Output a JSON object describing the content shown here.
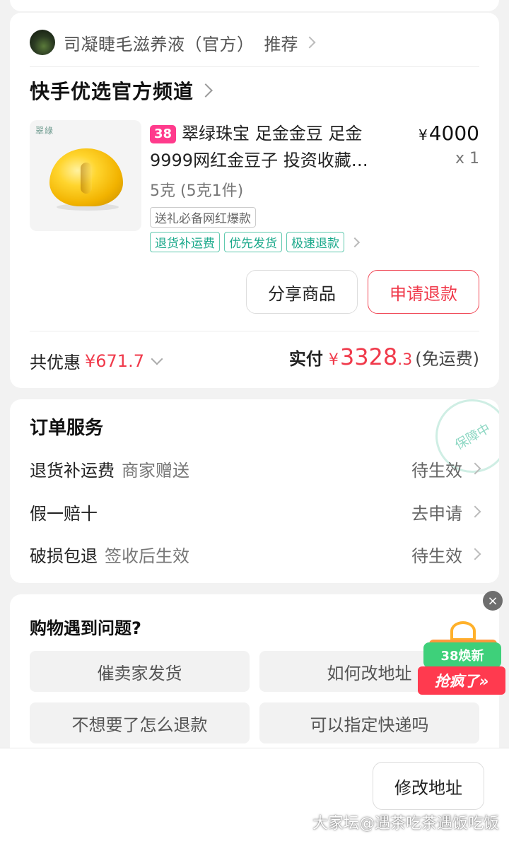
{
  "store": {
    "name": "司凝睫毛滋养液（官方）",
    "recommend": "推荐"
  },
  "channel": {
    "title": "快手优选官方频道"
  },
  "product": {
    "brand_mark": "翠綠",
    "badge": "38",
    "title_line1": "翠绿珠宝 足金金豆 足金",
    "title_line2": "9999网红金豆子 投资收藏…",
    "price_currency": "¥",
    "price": "4000",
    "quantity": "x 1",
    "spec": "5克 (5克1件)",
    "tag_gray": "送礼必备网红爆款",
    "tags_green": [
      "退货补运费",
      "优先发货",
      "极速退款"
    ]
  },
  "actions": {
    "share": "分享商品",
    "refund": "申请退款"
  },
  "summary": {
    "discount_label": "共优惠",
    "discount_amount": "¥671.7",
    "paid_label": "实付",
    "paid_currency": "¥",
    "paid_integer": "3328",
    "paid_decimal": ".3",
    "shipping": "(免运费)"
  },
  "order_service": {
    "title": "订单服务",
    "stamp": "保障中",
    "rows": [
      {
        "name": "退货补运费",
        "sub": "商家赠送",
        "status": "待生效"
      },
      {
        "name": "假一赔十",
        "sub": "",
        "status": "去申请"
      },
      {
        "name": "破损包退",
        "sub": "签收后生效",
        "status": "待生效"
      }
    ]
  },
  "problems": {
    "title": "购物遇到问题?",
    "buttons": [
      "催卖家发货",
      "如何改地址",
      "不想要了怎么退款",
      "可以指定快递吗"
    ]
  },
  "promo": {
    "top": "38焕新",
    "bottom": "抢疯了»"
  },
  "close_icon": "×",
  "bottom": {
    "modify_address": "修改地址",
    "watermark": "大家坛@遇茶吃茶遇饭吃饭"
  },
  "colors": {
    "accent_red": "#f03a4b",
    "green": "#19a88a",
    "badge_pink": "#ff3b8c"
  }
}
